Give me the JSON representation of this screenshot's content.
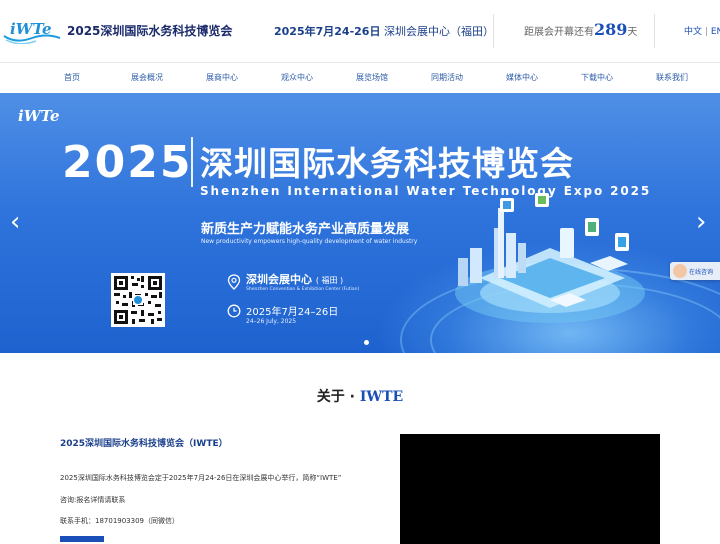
{
  "header": {
    "logo_text": "iWTe",
    "site_title": "2025深圳国际水务科技博览会",
    "date": "2025年7月24-26日",
    "location": "深圳会展中心（福田）",
    "countdown_prefix": "距展会开幕还有",
    "countdown_days": "289",
    "countdown_suffix": "天",
    "lang_zh": "中文",
    "lang_sep": "|",
    "lang_en": "EN"
  },
  "nav": {
    "items": [
      {
        "label": "首页"
      },
      {
        "label": "展会概况"
      },
      {
        "label": "展商中心"
      },
      {
        "label": "观众中心"
      },
      {
        "label": "展览场馆"
      },
      {
        "label": "同期活动"
      },
      {
        "label": "媒体中心"
      },
      {
        "label": "下载中心"
      },
      {
        "label": "联系我们"
      }
    ]
  },
  "banner": {
    "logo_text": "iWTe",
    "year": "2025",
    "title": "深圳国际水务科技博览会",
    "subtitle_en": "Shenzhen International Water Technology Expo 2025",
    "theme": "新质生产力赋能水务产业高质量发展",
    "theme_en": "New productivity empowers high-quality development of water industry",
    "venue": "深圳会展中心",
    "venue_note": "( 福田 )",
    "venue_en": "Shenzhen Convention & Exhibition Center (Futian)",
    "date": "2025年7月24–26日",
    "date_en": "24–26 July, 2025",
    "prev_arrow": "‹",
    "next_arrow": "›"
  },
  "chat": {
    "label": "在线咨询"
  },
  "about": {
    "title_zh": "关于 · ",
    "title_en": "IWTE",
    "heading": "2025深圳国际水务科技博览会（IWTE）",
    "paragraph": "2025深圳国际水务科技博览会定于2025年7月24-26日在深圳会展中心举行，简称“IWTE”",
    "consult": "咨询:报名详情请联系",
    "phone": "联系手机：18701903309（同微信）"
  },
  "colors": {
    "brand_blue": "#1a4fb8",
    "banner_blue": "#2f74dc",
    "nav_text": "#2d5ca8"
  }
}
